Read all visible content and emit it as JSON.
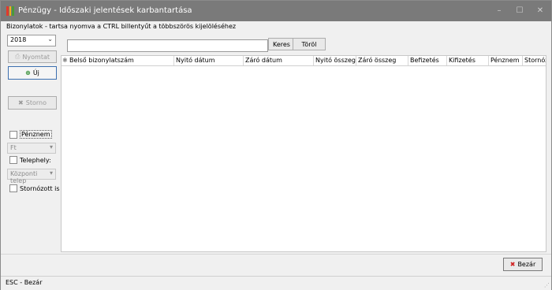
{
  "window": {
    "title": "Pénzügy - Időszaki jelentések karbantartása",
    "minimize": "–",
    "maximize": "☐",
    "close": "✕"
  },
  "subtitle": "Bizonylatok - tartsa nyomva a CTRL billentyűt a többszörös kijelöléséhez",
  "sidebar": {
    "year": "2018",
    "print_label": "Nyomtat",
    "new_label": "Új",
    "storno_label": "Storno",
    "currency_label": "Pénznem",
    "currency_value": "Ft",
    "site_label": "Telephely:",
    "site_value": "Központi teleр",
    "reversed_label": "Stornózott is"
  },
  "search": {
    "placeholder": "",
    "search_label": "Keres",
    "clear_label": "Töröl"
  },
  "grid": {
    "marker": "✱",
    "columns": [
      "Belső bizonylatszám",
      "Nyitó dátum",
      "Záró dátum",
      "Nyitó összeg",
      "Záró összeg",
      "Befizetés",
      "Kifizetés",
      "Pénznem",
      "Stornózo"
    ]
  },
  "footer": {
    "close_label": "Bezár"
  },
  "status": {
    "text": "ESC - Bezár",
    "grip": "⋰"
  },
  "colors": {
    "titlebar": "#7a7a7a",
    "logo": [
      "#e23a2a",
      "#f2b01e",
      "#4a9a3a"
    ]
  }
}
